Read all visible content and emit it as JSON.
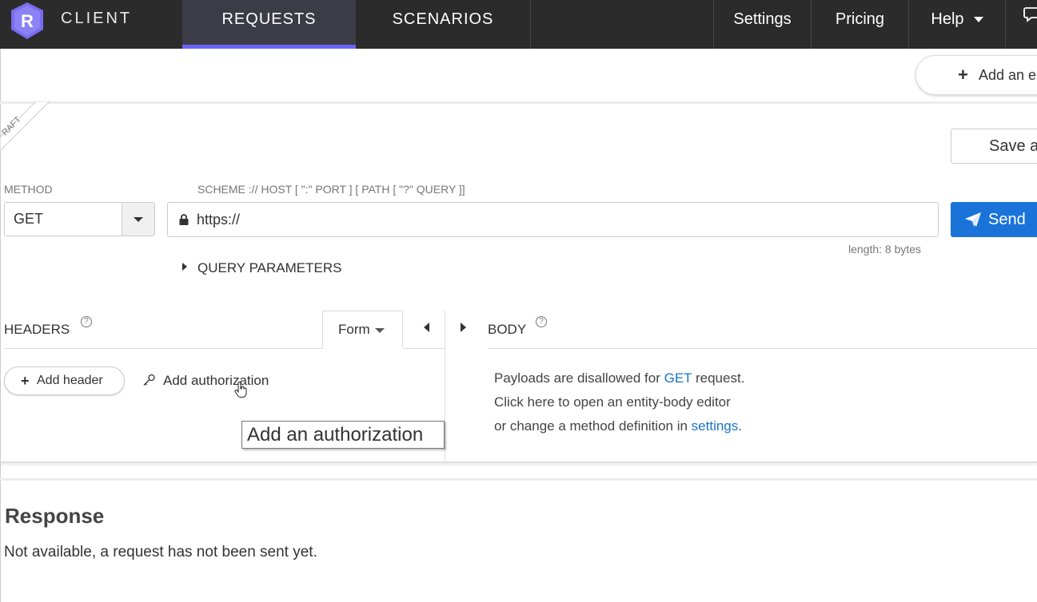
{
  "app": {
    "brand": "CLIENT",
    "logo_letter": "R"
  },
  "nav": {
    "tabs": [
      {
        "label": "REQUESTS",
        "active": true
      },
      {
        "label": "SCENARIOS",
        "active": false
      }
    ],
    "settings": "Settings",
    "pricing": "Pricing",
    "help": "Help"
  },
  "toolbar": {
    "add_env_label": "Add an en",
    "save_label": "Save a",
    "draft_label": "RAFT"
  },
  "request": {
    "method_label": "METHOD",
    "method_value": "GET",
    "url_label": "SCHEME :// HOST [ \":\" PORT ] [ PATH [ \"?\" QUERY ]]",
    "url_value": "https://",
    "send_label": "Send",
    "length_text": "length: 8 bytes",
    "query_params_label": "QUERY PARAMETERS"
  },
  "headers": {
    "title": "HEADERS",
    "help": "?",
    "form_label": "Form",
    "add_header_label": "Add header",
    "add_auth_label": "Add authorization",
    "tooltip": "Add an authorization"
  },
  "body": {
    "title": "BODY",
    "help": "?",
    "line1_pre": "Payloads are disallowed for ",
    "line1_link": "GET",
    "line1_post": " request.",
    "line2": "Click here to open an entity-body editor",
    "line3_pre": "or change a method definition in ",
    "line3_link": "settings",
    "line3_post": "."
  },
  "response": {
    "title": "Response",
    "message": "Not available, a request has not been sent yet."
  },
  "colors": {
    "accent": "#6c63ff",
    "send": "#1a73d8",
    "link": "#1a73c8",
    "topbar": "#2b2b2b"
  }
}
